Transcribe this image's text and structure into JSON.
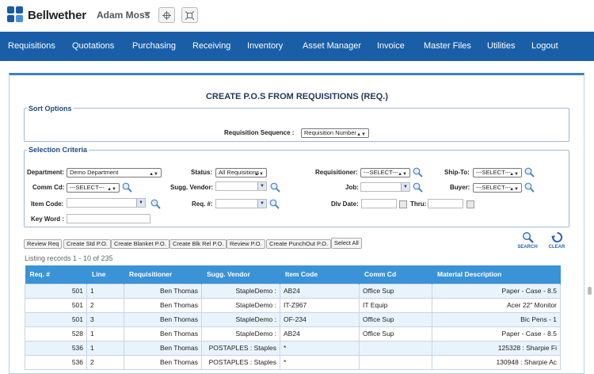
{
  "app": {
    "name": "Bellwether",
    "user": "Adam Moss"
  },
  "nav": [
    "Requisitions",
    "Quotations",
    "Purchasing",
    "Receiving",
    "Inventory",
    "Asset Manager",
    "Invoice",
    "Master Files",
    "Utilities",
    "Logout"
  ],
  "page_title": "CREATE P.O.S FROM REQUISITIONS (REQ.)",
  "sort": {
    "legend": "Sort Options",
    "label": "Requisition Sequence :",
    "value": "Requisition Number"
  },
  "criteria": {
    "legend": "Selection Criteria",
    "department_label": "Department:",
    "department_value": "Demo Department",
    "status_label": "Status:",
    "status_value": "All Requisitions",
    "requisitioner_label": "Requisitioner:",
    "requisitioner_value": "---SELECT---",
    "shipto_label": "Ship-To:",
    "shipto_value": "---SELECT---",
    "commcd_label": "Comm Cd:",
    "commcd_value": "---SELECT---",
    "vendor_label": "Sugg. Vendor:",
    "job_label": "Job:",
    "buyer_label": "Buyer:",
    "buyer_value": "---SELECT---",
    "itemcode_label": "Item Code:",
    "req_label": "Req. #:",
    "dlvdate_label": "Dlv Date:",
    "thru_label": "Thru:",
    "keyword_label": "Key Word :"
  },
  "actions": [
    "Review Req",
    "Create Std P.O.",
    "Create Blanket P.O.",
    "Create Blk Rel P.O.",
    "Review P.O.",
    "Create PunchOut P.O.",
    "Select All"
  ],
  "search_label": "SEARCH",
  "clear_label": "CLEAR",
  "listing": "Listing records 1 - 10 of 235",
  "table": {
    "headers": [
      "Req. #",
      "Line",
      "Requisitioner",
      "Sugg. Vendor",
      "Item Code",
      "Comm Cd",
      "Material Description"
    ],
    "rows": [
      [
        "501",
        "1",
        "Ben Thomas",
        "StapleDemo :",
        "AB24",
        "Office Sup",
        "Paper - Case - 8.5"
      ],
      [
        "501",
        "2",
        "Ben Thomas",
        "StapleDemo :",
        "IT-Z967",
        "IT Equip",
        "Acer 22\" Monitor"
      ],
      [
        "501",
        "3",
        "Ben Thomas",
        "StapleDemo :",
        "OF-234",
        "Office Sup",
        "Bic Pens - 1"
      ],
      [
        "528",
        "1",
        "Ben Thomas",
        "StapleDemo :",
        "AB24",
        "Office Sup",
        "Paper - Case - 8.5"
      ],
      [
        "536",
        "1",
        "Ben Thomas",
        "POSTAPLES : Staples",
        "*",
        "",
        "125328 : Sharpie Fi"
      ],
      [
        "536",
        "2",
        "Ben Thomas",
        "POSTAPLES : Staples",
        "*",
        "",
        "130948 : Sharpie Ac"
      ]
    ]
  }
}
